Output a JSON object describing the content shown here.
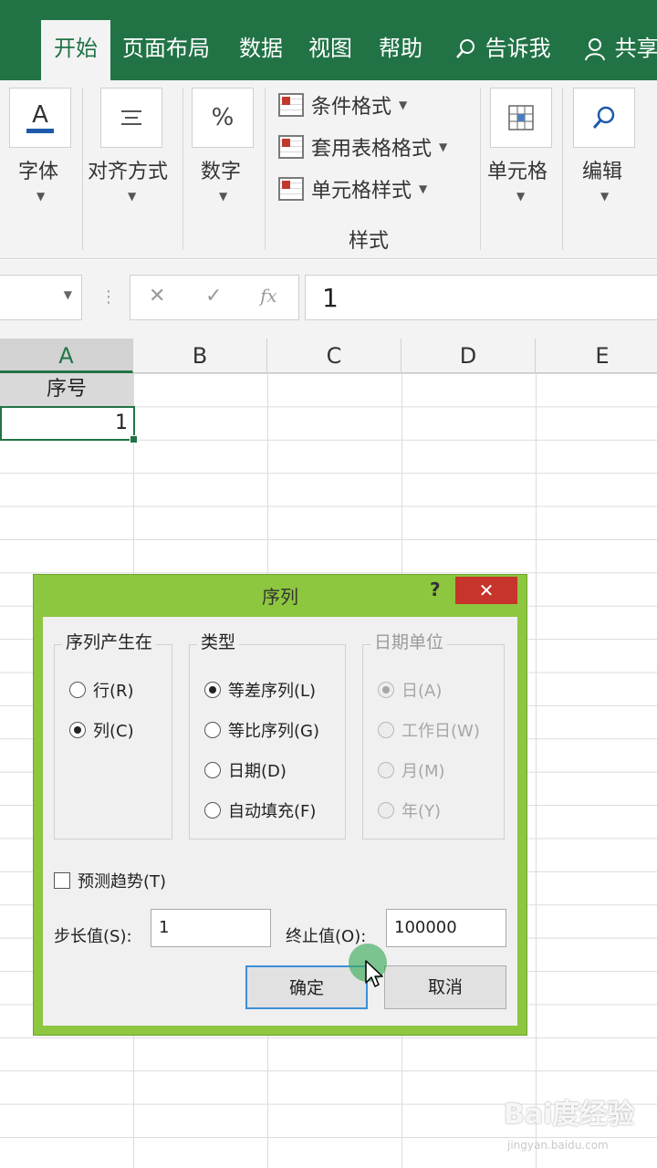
{
  "ribbon_tabs": {
    "home": "开始",
    "page_layout": "页面布局",
    "data": "数据",
    "view": "视图",
    "help": "帮助",
    "tell_me": "告诉我",
    "share": "共享"
  },
  "ribbon": {
    "font_label": "字体",
    "font_icon": "A",
    "align_label": "对齐方式",
    "number_label": "数字",
    "number_icon": "%",
    "styles": {
      "conditional": "条件格式",
      "table": "套用表格格式",
      "cell_styles": "单元格样式",
      "group_label": "样式"
    },
    "cells_label": "单元格",
    "edit_label": "编辑"
  },
  "formula_bar": {
    "cancel": "✕",
    "enter": "✓",
    "fx": "fx",
    "value": "1"
  },
  "sheet": {
    "columns": [
      "A",
      "B",
      "C",
      "D",
      "E"
    ],
    "a1": "序号",
    "a2": "1"
  },
  "dialog": {
    "title": "序列",
    "help": "?",
    "close": "✕",
    "series_in": {
      "legend": "序列产生在",
      "rows": "行(R)",
      "cols": "列(C)"
    },
    "type": {
      "legend": "类型",
      "linear": "等差序列(L)",
      "growth": "等比序列(G)",
      "date": "日期(D)",
      "autofill": "自动填充(F)"
    },
    "date_unit": {
      "legend": "日期单位",
      "day": "日(A)",
      "weekday": "工作日(W)",
      "month": "月(M)",
      "year": "年(Y)"
    },
    "trend": "预测趋势(T)",
    "step_label": "步长值(S):",
    "step_value": "1",
    "stop_label": "终止值(O):",
    "stop_value": "100000",
    "ok": "确定",
    "cancel": "取消"
  },
  "watermark": {
    "brand": "Bai度经验",
    "url": "jingyan.baidu.com"
  },
  "colors": {
    "excel_green": "#217346",
    "dialog_border": "#8dc63f",
    "close_red": "#c7342b"
  }
}
